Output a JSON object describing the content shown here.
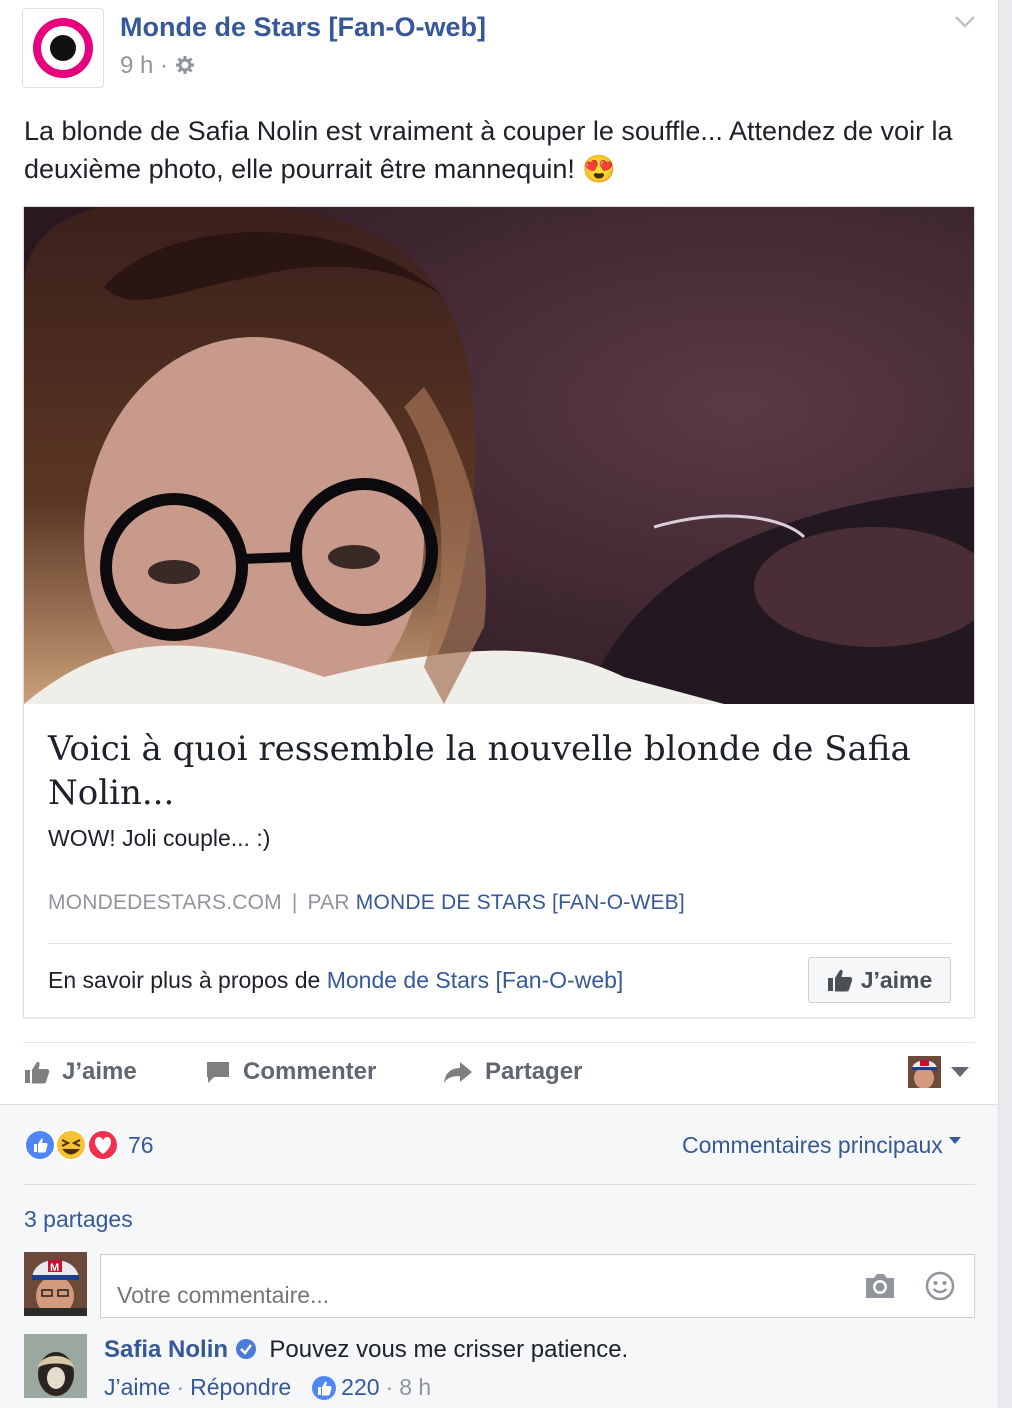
{
  "post": {
    "page_name": "Monde de Stars [Fan-O-web]",
    "time": "9 h",
    "meta_dot": "·",
    "status_text": "La blonde de Safia Nolin est vraiment à couper le souffle... Attendez de voir la deuxième photo, elle pourrait être mannequin! 😍",
    "colors": {
      "link": "#365899",
      "logo_pink": "#e6007e"
    }
  },
  "link_card": {
    "title": "Voici à quoi ressemble la nouvelle blonde de Safia Nolin...",
    "description": "WOW! Joli couple... :)",
    "domain": "MONDEDESTARS.COM",
    "separator": "|",
    "by_prefix": "PAR",
    "by_name": "MONDE DE STARS [FAN-O-WEB]",
    "footer_prefix": "En savoir plus à propos de",
    "footer_link": "Monde de Stars [Fan-O-web]",
    "like_button": "J’aime"
  },
  "actions": {
    "like": "J’aime",
    "comment": "Commenter",
    "share": "Partager"
  },
  "stats": {
    "reaction_count": "76",
    "sort_label": "Commentaires principaux",
    "shares": "3 partages"
  },
  "composer": {
    "placeholder": "Votre commentaire..."
  },
  "comment": {
    "author": "Safia Nolin",
    "text": "Pouvez vous me crisser patience.",
    "like": "J’aime",
    "reply": "Répondre",
    "likes": "220",
    "time": "8 h",
    "dot": "·"
  }
}
